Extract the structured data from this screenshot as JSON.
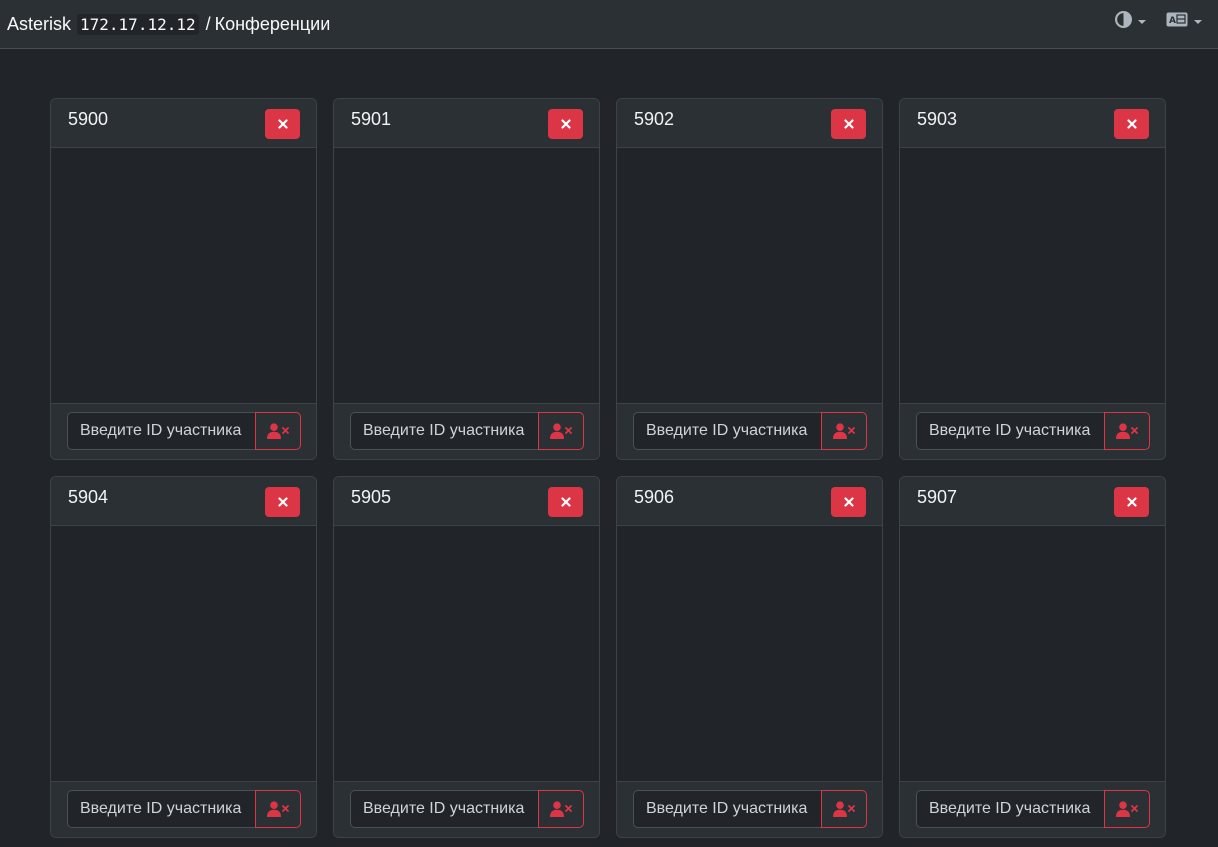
{
  "header": {
    "app_name": "Asterisk",
    "host": "172.17.12.12",
    "separator": "/",
    "page": "Конференции",
    "theme_icon": "contrast-icon",
    "language_icon": "translate-icon"
  },
  "conferences": [
    {
      "number": "5900",
      "placeholder": "Введите ID участника"
    },
    {
      "number": "5901",
      "placeholder": "Введите ID участника"
    },
    {
      "number": "5902",
      "placeholder": "Введите ID участника"
    },
    {
      "number": "5903",
      "placeholder": "Введите ID участника"
    },
    {
      "number": "5904",
      "placeholder": "Введите ID участника"
    },
    {
      "number": "5905",
      "placeholder": "Введите ID участника"
    },
    {
      "number": "5906",
      "placeholder": "Введите ID участника"
    },
    {
      "number": "5907",
      "placeholder": "Введите ID участника"
    }
  ],
  "colors": {
    "danger": "#dc3545",
    "background": "#212529",
    "surface": "#2b3035"
  }
}
